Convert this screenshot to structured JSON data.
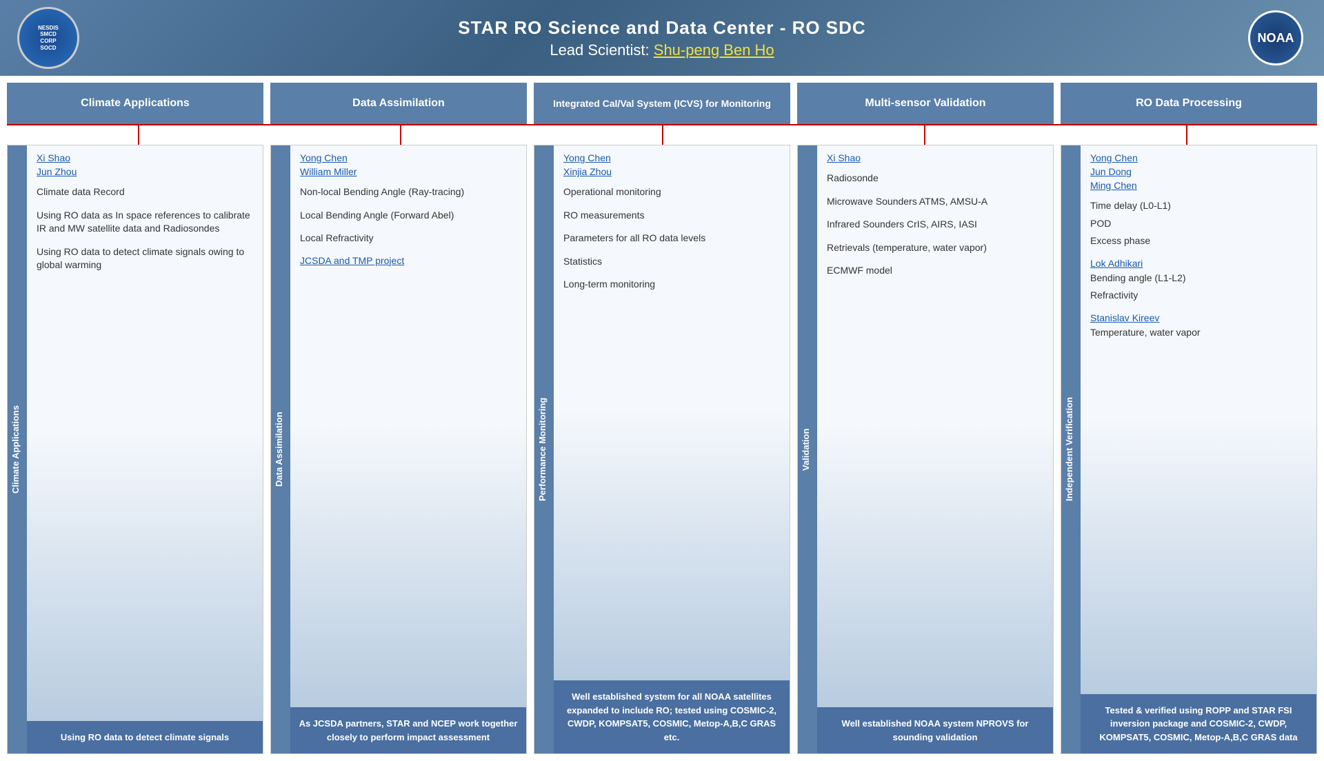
{
  "header": {
    "title": "STAR RO Science and Data Center - RO SDC",
    "subtitle_prefix": "Lead Scientist: ",
    "lead_scientist": "Shu-peng Ben Ho",
    "logo_left_text": "NESDIS\nSMCD\nCORP\nSOCD",
    "logo_right_text": "NOAA"
  },
  "columns": [
    {
      "id": "climate",
      "header": "Climate Applications",
      "rotated_label": "Climate Applications",
      "links": [
        "Xi Shao",
        "Jun Zhou"
      ],
      "content_lines": [
        "Climate data  Record",
        "Using RO data as  In space references to calibrate IR and  MW satellite data and Radiosondes",
        "Using RO data to detect climate signals owing to global warming"
      ],
      "footer": "Using RO data to detect climate signals"
    },
    {
      "id": "assimilation",
      "header": "Data Assimilation",
      "rotated_label": "Data Assimilation",
      "links": [
        "Yong Chen",
        "William Miller"
      ],
      "content_lines": [
        "Non-local Bending Angle (Ray-tracing)",
        "Local Bending Angle (Forward Abel)",
        "Local Refractivity"
      ],
      "link2": "JCSDA and TMP project",
      "footer": "As JCSDA partners, STAR and NCEP work together closely to perform impact assessment"
    },
    {
      "id": "icvs",
      "header": "Integrated Cal/Val System  (ICVS)  for Monitoring",
      "rotated_label": "Performance Monitoring",
      "links": [
        "Yong Chen",
        "Xinjia Zhou"
      ],
      "content_lines": [
        "Operational monitoring",
        "RO measurements",
        "Parameters for all RO data levels",
        "Statistics",
        "Long-term monitoring"
      ],
      "footer": "Well established system for all NOAA satellites expanded to include RO; tested using COSMIC-2, CWDP, KOMPSAT5, COSMIC, Metop-A,B,C GRAS etc."
    },
    {
      "id": "validation",
      "header": "Multi-sensor Validation",
      "rotated_label": "Validation",
      "links": [
        "Xi Shao"
      ],
      "content_lines": [
        "Radiosonde",
        "Microwave Sounders ATMS, AMSU-A",
        "Infrared Sounders CrIS, AIRS, IASI",
        "Retrievals (temperature, water vapor)",
        "ECMWF model"
      ],
      "footer": "Well established NOAA system NPROVS for sounding validation"
    },
    {
      "id": "processing",
      "header": "RO Data Processing",
      "rotated_label": "Independent Verification",
      "links": [
        "Yong Chen",
        "Jun Dong",
        "Ming Chen"
      ],
      "content_lines": [
        "Time delay (L0-L1)",
        "POD",
        "Excess phase"
      ],
      "link2": "Lok Adhikari",
      "content_lines2": [
        "Bending angle (L1-L2)",
        "Refractivity"
      ],
      "link3": "Stanislav Kireev",
      "content_lines3": [
        "Temperature, water vapor"
      ],
      "footer": "Tested & verified using ROPP and  STAR FSI inversion package and COSMIC-2, CWDP, KOMPSAT5, COSMIC, Metop-A,B,C GRAS data"
    }
  ]
}
